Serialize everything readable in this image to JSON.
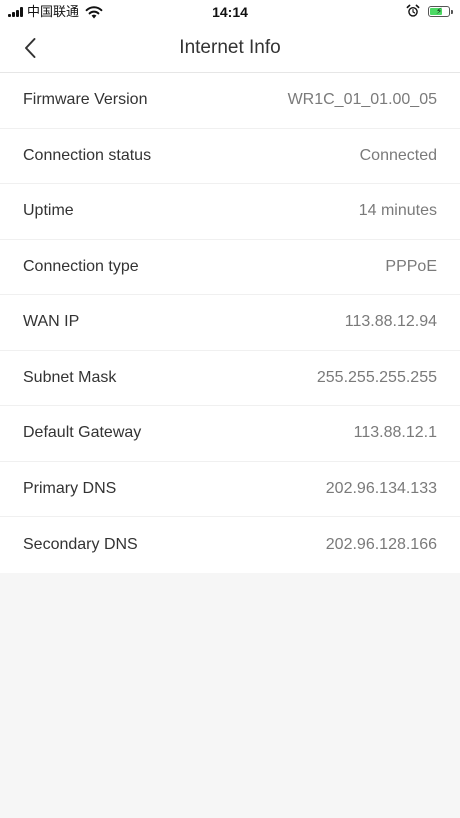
{
  "status_bar": {
    "carrier": "中国联通",
    "time": "14:14",
    "battery_bolt": "⚡"
  },
  "header": {
    "title": "Internet Info"
  },
  "rows": [
    {
      "label": "Firmware Version",
      "value": "WR1C_01_01.00_05"
    },
    {
      "label": "Connection status",
      "value": "Connected"
    },
    {
      "label": "Uptime",
      "value": "14 minutes"
    },
    {
      "label": "Connection type",
      "value": "PPPoE"
    },
    {
      "label": "WAN IP",
      "value": "113.88.12.94"
    },
    {
      "label": "Subnet Mask",
      "value": "255.255.255.255"
    },
    {
      "label": "Default Gateway",
      "value": "113.88.12.1"
    },
    {
      "label": "Primary DNS",
      "value": "202.96.134.133"
    },
    {
      "label": "Secondary DNS",
      "value": "202.96.128.166"
    }
  ],
  "colors": {
    "battery_fill": "#4cd964",
    "background": "#f6f6f6"
  }
}
